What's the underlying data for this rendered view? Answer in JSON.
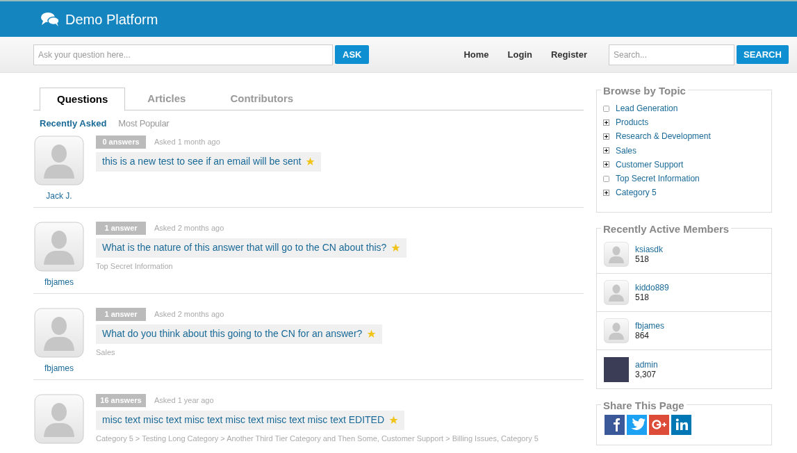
{
  "header": {
    "title": "Demo Platform"
  },
  "toolbar": {
    "ask_field": {
      "placeholder": "Ask your question here..."
    },
    "ask_button": "ASK",
    "nav": [
      "Home",
      "Login",
      "Register"
    ],
    "search_field": {
      "placeholder": "Search..."
    },
    "search_button": "SEARCH"
  },
  "tabs": [
    {
      "label": "Questions",
      "selected": true
    },
    {
      "label": "Articles",
      "selected": false
    },
    {
      "label": "Contributors",
      "selected": false
    }
  ],
  "subtabs": [
    {
      "label": "Recently Asked",
      "selected": true
    },
    {
      "label": "Most Popular",
      "selected": false
    }
  ],
  "questions": [
    {
      "author": "Jack J.",
      "answers": "0 answers",
      "asked": "Asked 1 month ago",
      "title": "this is a new test to see if an email will be sent"
    },
    {
      "author": "fbjames",
      "answers": "1 answer",
      "asked": "Asked 2 months ago",
      "title": "What is the nature of this answer that will go to the CN about this?",
      "categories": "Top Secret Information"
    },
    {
      "author": "fbjames",
      "answers": "1 answer",
      "asked": "Asked 2 months ago",
      "title": "What do you think about this going to the CN for an answer?",
      "categories": "Sales"
    },
    {
      "answers": "16 answers",
      "asked": "Asked 1 year ago",
      "title": "misc text misc text misc text misc text misc text misc text EDITED",
      "categories": "Category 5 > Testing Long Category > Another Third Tier Category and Then Some, Customer Support > Billing Issues, Category 5"
    }
  ],
  "browse": {
    "title": "Browse by Topic",
    "items": [
      {
        "label": "Lead Generation",
        "kind": "leaf"
      },
      {
        "label": "Products",
        "kind": "expandable"
      },
      {
        "label": "Research & Development",
        "kind": "expandable"
      },
      {
        "label": "Sales",
        "kind": "expandable"
      },
      {
        "label": "Customer Support",
        "kind": "expandable"
      },
      {
        "label": "Top Secret Information",
        "kind": "leaf"
      },
      {
        "label": "Category 5",
        "kind": "expandable"
      }
    ]
  },
  "members": {
    "title": "Recently Active Members",
    "items": [
      {
        "name": "ksiasdk",
        "points": "518",
        "kind": "default"
      },
      {
        "name": "kiddo889",
        "points": "518",
        "kind": "default"
      },
      {
        "name": "fbjames",
        "points": "864",
        "kind": "default"
      },
      {
        "name": "admin",
        "points": "3,307",
        "kind": "photo"
      }
    ]
  },
  "share": {
    "title": "Share This Page",
    "networks": [
      {
        "kind": "facebook",
        "color": "#3b5998"
      },
      {
        "kind": "twitter",
        "color": "#1da1f2"
      },
      {
        "kind": "googleplus",
        "color": "#dd4b39"
      },
      {
        "kind": "linkedin",
        "color": "#0077b5"
      }
    ]
  }
}
